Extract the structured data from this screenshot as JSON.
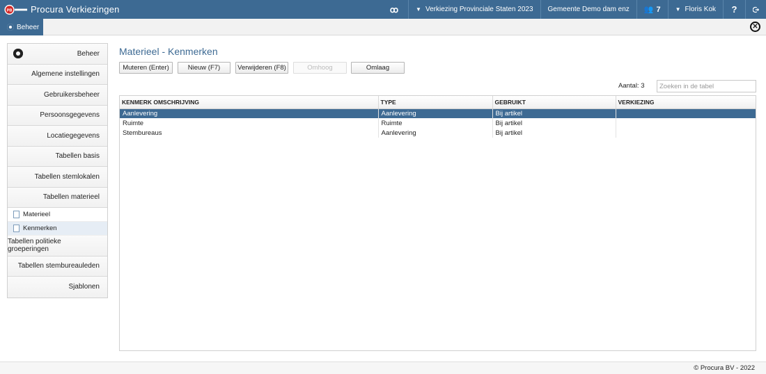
{
  "app": {
    "title": "Procura Verkiezingen"
  },
  "topbar": {
    "election": "Verkiezing Provinciale Staten 2023",
    "municipality": "Gemeente Demo dam enz",
    "users_count": "7",
    "user_name": "Floris Kok",
    "help": "?"
  },
  "tabs": {
    "active": "Beheer"
  },
  "sidebar": {
    "header": "Beheer",
    "items": [
      "Algemene instellingen",
      "Gebruikersbeheer",
      "Persoonsgegevens",
      "Locatiegegevens",
      "Tabellen basis",
      "Tabellen stemlokalen",
      "Tabellen materieel"
    ],
    "subitems": [
      "Materieel",
      "Kenmerken"
    ],
    "items_after": [
      "Tabellen politieke groeperingen",
      "Tabellen stembureauleden",
      "Sjablonen"
    ]
  },
  "main": {
    "title": "Materieel - Kenmerken",
    "buttons": {
      "edit": "Muteren (Enter)",
      "new": "Nieuw (F7)",
      "delete": "Verwijderen (F8)",
      "up": "Omhoog",
      "down": "Omlaag"
    },
    "count_label": "Aantal: 3",
    "search_placeholder": "Zoeken in de tabel",
    "table": {
      "headers": [
        "KENMERK OMSCHRIJVING",
        "TYPE",
        "GEBRUIKT",
        "VERKIEZING"
      ],
      "rows": [
        [
          "Aanlevering",
          "Aanlevering",
          "Bij artikel",
          ""
        ],
        [
          "Ruimte",
          "Ruimte",
          "Bij artikel",
          ""
        ],
        [
          "Stembureaus",
          "Aanlevering",
          "Bij artikel",
          ""
        ]
      ]
    }
  },
  "footer": {
    "copyright": "© Procura BV - 2022"
  },
  "colors": {
    "accent": "#3d6a93"
  }
}
